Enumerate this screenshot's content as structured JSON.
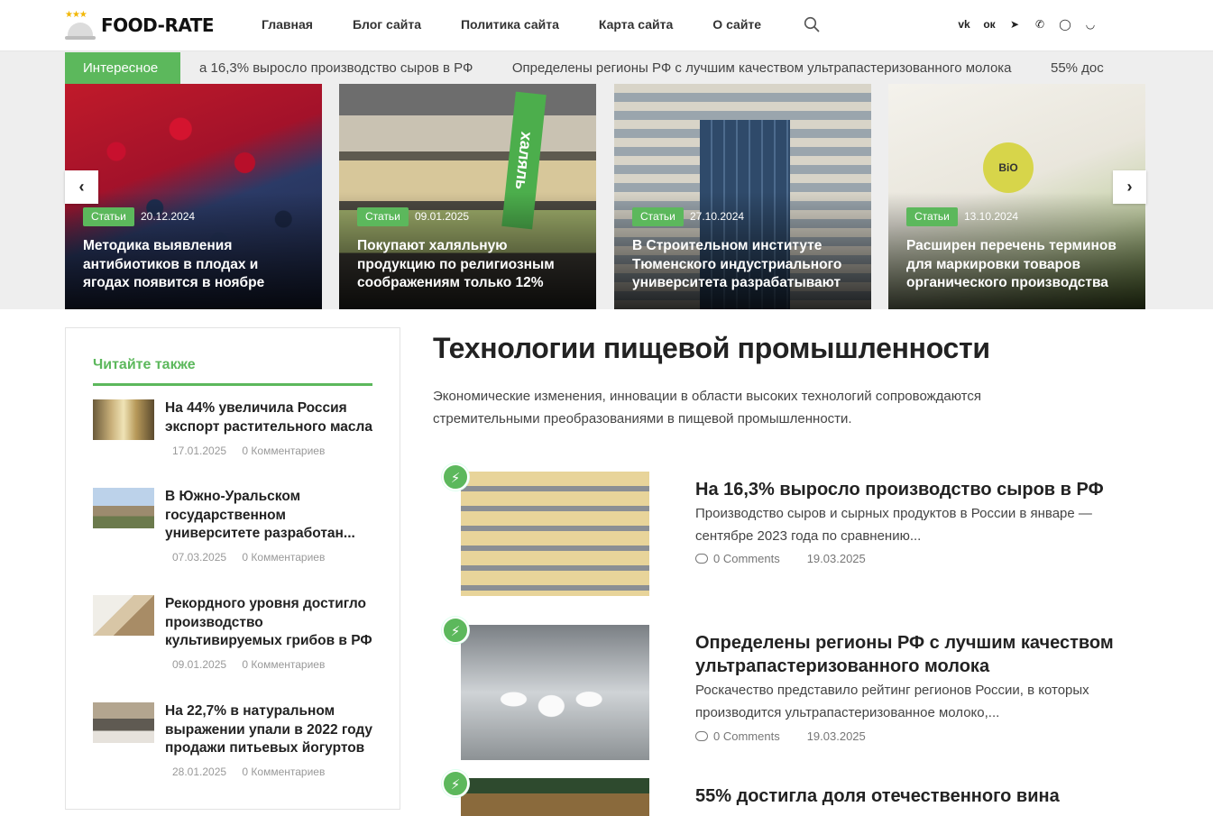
{
  "header": {
    "logo_text": "FOOD-RATE",
    "nav": [
      "Главная",
      "Блог сайта",
      "Политика сайта",
      "Карта сайта",
      "О сайте"
    ],
    "social_icons": [
      "vk-icon",
      "odnoklassniki-icon",
      "telegram-icon",
      "viber-icon",
      "whatsapp-icon",
      "yandex-zen-icon"
    ]
  },
  "ticker": {
    "label": "Интересное",
    "items": [
      "а 16,3% выросло производство сыров в РФ",
      "Определены регионы РФ с лучшим качеством ультрапастеризованного молока",
      "55% дос"
    ]
  },
  "slider": {
    "cards": [
      {
        "badge": "Статьи",
        "date": "20.12.2024",
        "title": "Методика выявления антибиотиков в плодах и ягодах появится в ноябре"
      },
      {
        "badge": "Статьи",
        "date": "09.01.2025",
        "title": "Покупают халяльную продукцию по религиозным соображениям только 12%"
      },
      {
        "badge": "Статьи",
        "date": "27.10.2024",
        "title": "В Строительном институте Тюменского индустриального университета разрабатывают"
      },
      {
        "badge": "Статьи",
        "date": "13.10.2024",
        "title": "Расширен перечень терминов для маркировки товаров органического производства"
      }
    ],
    "prev_label": "‹",
    "next_label": "›"
  },
  "sidebar": {
    "title": "Читайте также",
    "items": [
      {
        "title": "На 44% увеличила Россия экспорт растительного масла",
        "date": "17.01.2025",
        "comments": "0 Комментариев"
      },
      {
        "title": "В Южно-Уральском государственном университете разработан...",
        "date": "07.03.2025",
        "comments": "0 Комментариев"
      },
      {
        "title": "Рекордного уровня достигло производство культивируемых грибов в РФ",
        "date": "09.01.2025",
        "comments": "0 Комментариев"
      },
      {
        "title": "На 22,7% в натуральном выражении упали в 2022 году продажи питьевых йогуртов",
        "date": "28.01.2025",
        "comments": "0 Комментариев"
      }
    ]
  },
  "main": {
    "title": "Технологии пищевой промышленности",
    "description": "Экономические изменения, инновации в области высоких технологий сопровождаются стремительными преобразованиями в пищевой промышленности.",
    "posts": [
      {
        "title": "На 16,3% выросло производство сыров в РФ",
        "excerpt": "Производство сыров и сырных продуктов в России в январе — сентябре 2023 года по сравнению...",
        "comments": "0 Comments",
        "date": "19.03.2025"
      },
      {
        "title": "Определены регионы РФ с лучшим качеством ультрапастеризованного молока",
        "excerpt": "Роскачество представило рейтинг регионов России, в которых производится ультрапастеризованное молоко,...",
        "comments": "0 Comments",
        "date": "19.03.2025"
      },
      {
        "title": "55% достигла доля отечественного вина",
        "excerpt": "",
        "comments": "",
        "date": ""
      }
    ]
  },
  "colors": {
    "accent": "#5cb85c",
    "band": "#eeeeee",
    "text": "#222222"
  }
}
